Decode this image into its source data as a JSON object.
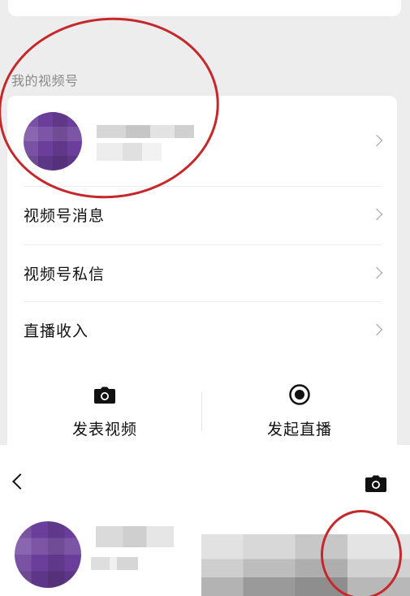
{
  "section": {
    "label": "我的视频号"
  },
  "menu": {
    "items": [
      {
        "label": "视频号消息"
      },
      {
        "label": "视频号私信"
      },
      {
        "label": "直播收入"
      }
    ]
  },
  "actions": {
    "post_video": {
      "label": "发表视频",
      "icon": "camera-icon"
    },
    "start_live": {
      "label": "发起直播",
      "icon": "live-record-icon"
    }
  },
  "profile_page": {
    "back_icon": "chevron-left-icon",
    "camera_icon": "camera-icon"
  },
  "colors": {
    "background": "#ededed",
    "card": "#ffffff",
    "annotation": "#c6282a",
    "avatar": "#6a3e9a"
  }
}
